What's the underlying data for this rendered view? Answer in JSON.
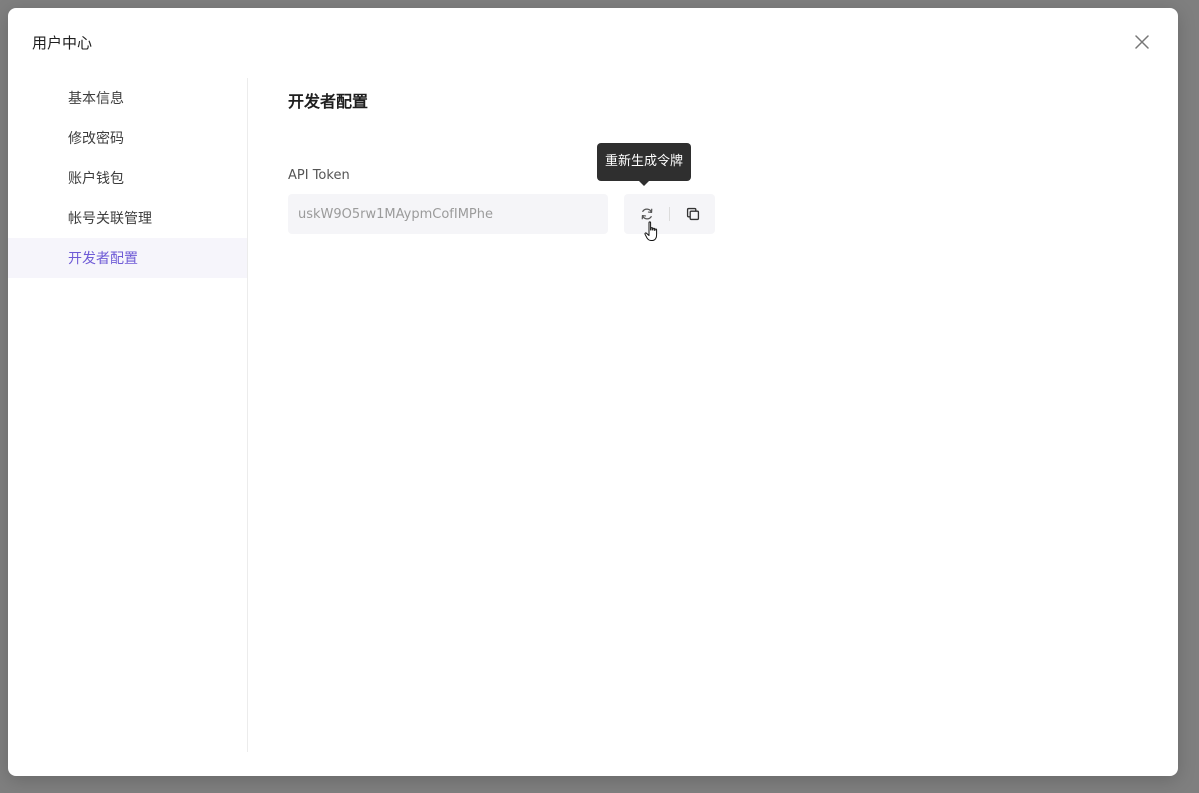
{
  "modal": {
    "title": "用户中心"
  },
  "sidebar": {
    "items": [
      {
        "label": "基本信息",
        "active": false
      },
      {
        "label": "修改密码",
        "active": false
      },
      {
        "label": "账户钱包",
        "active": false
      },
      {
        "label": "帐号关联管理",
        "active": false
      },
      {
        "label": "开发者配置",
        "active": true
      }
    ]
  },
  "main": {
    "section_title": "开发者配置",
    "api_token": {
      "label": "API Token",
      "value": "uskW9O5rw1MAypmCofIMPhe"
    },
    "actions": {
      "regenerate_tooltip": "重新生成令牌",
      "regenerate_icon": "refresh-icon",
      "copy_icon": "copy-icon"
    }
  },
  "colors": {
    "accent": "#6f5bd6",
    "active_bg": "#f6f5fb",
    "tooltip_bg": "#2f2f2f",
    "overlay": "#7f7f7f"
  }
}
